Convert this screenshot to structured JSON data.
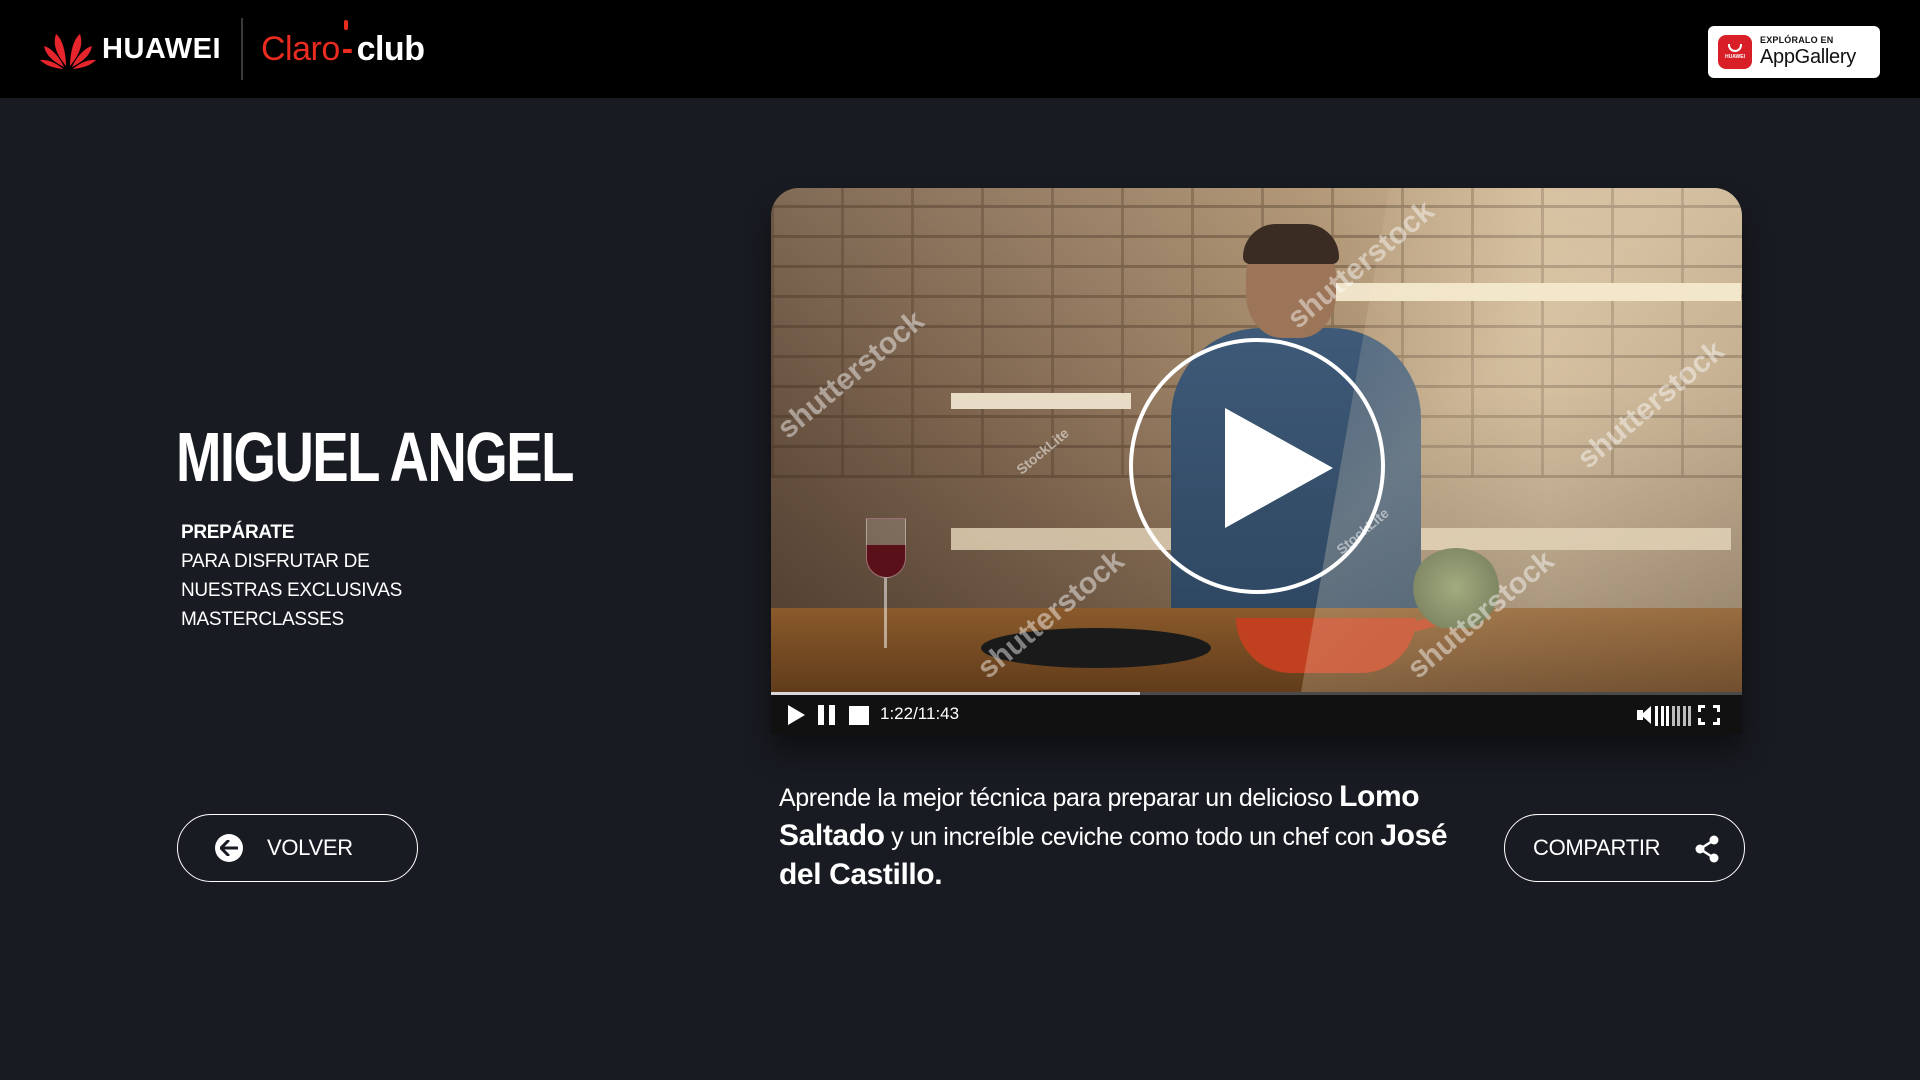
{
  "header": {
    "brand_huawei": "HUAWEI",
    "brand_claro": "Claro",
    "brand_club": "club",
    "appgallery_small": "EXPLÓRALO EN",
    "appgallery_big": "AppGallery",
    "appgallery_icon_text": "HUAWEI"
  },
  "hero": {
    "title": "MIGUEL ANGEL",
    "subtitle_bold": "PREPÁRATE",
    "subtitle_lines": [
      "PARA DISFRUTAR DE",
      "NUESTRAS EXCLUSIVAS",
      "MASTERCLASSES"
    ]
  },
  "video": {
    "time": "1:22/11:43",
    "progress": 0.38,
    "volume_bars": 7,
    "watermarks": [
      "shutterstock",
      "shutterstock",
      "shutterstock",
      "shutterstock",
      "shutterstock"
    ],
    "watermarks_small": [
      "StockLite",
      "StockLite"
    ]
  },
  "description": {
    "part1": "Aprende la mejor técnica para preparar un delicioso ",
    "bold1": "Lomo Saltado",
    "part2": " y un increíble ceviche como todo un chef con ",
    "bold2": "José del Castillo."
  },
  "buttons": {
    "back_label": "VOLVER",
    "share_label": "COMPARTIR"
  },
  "colors": {
    "background": "#181b21",
    "header": "#000000",
    "claro_red": "#ea2b1f",
    "huawei_red": "#d81e27"
  }
}
